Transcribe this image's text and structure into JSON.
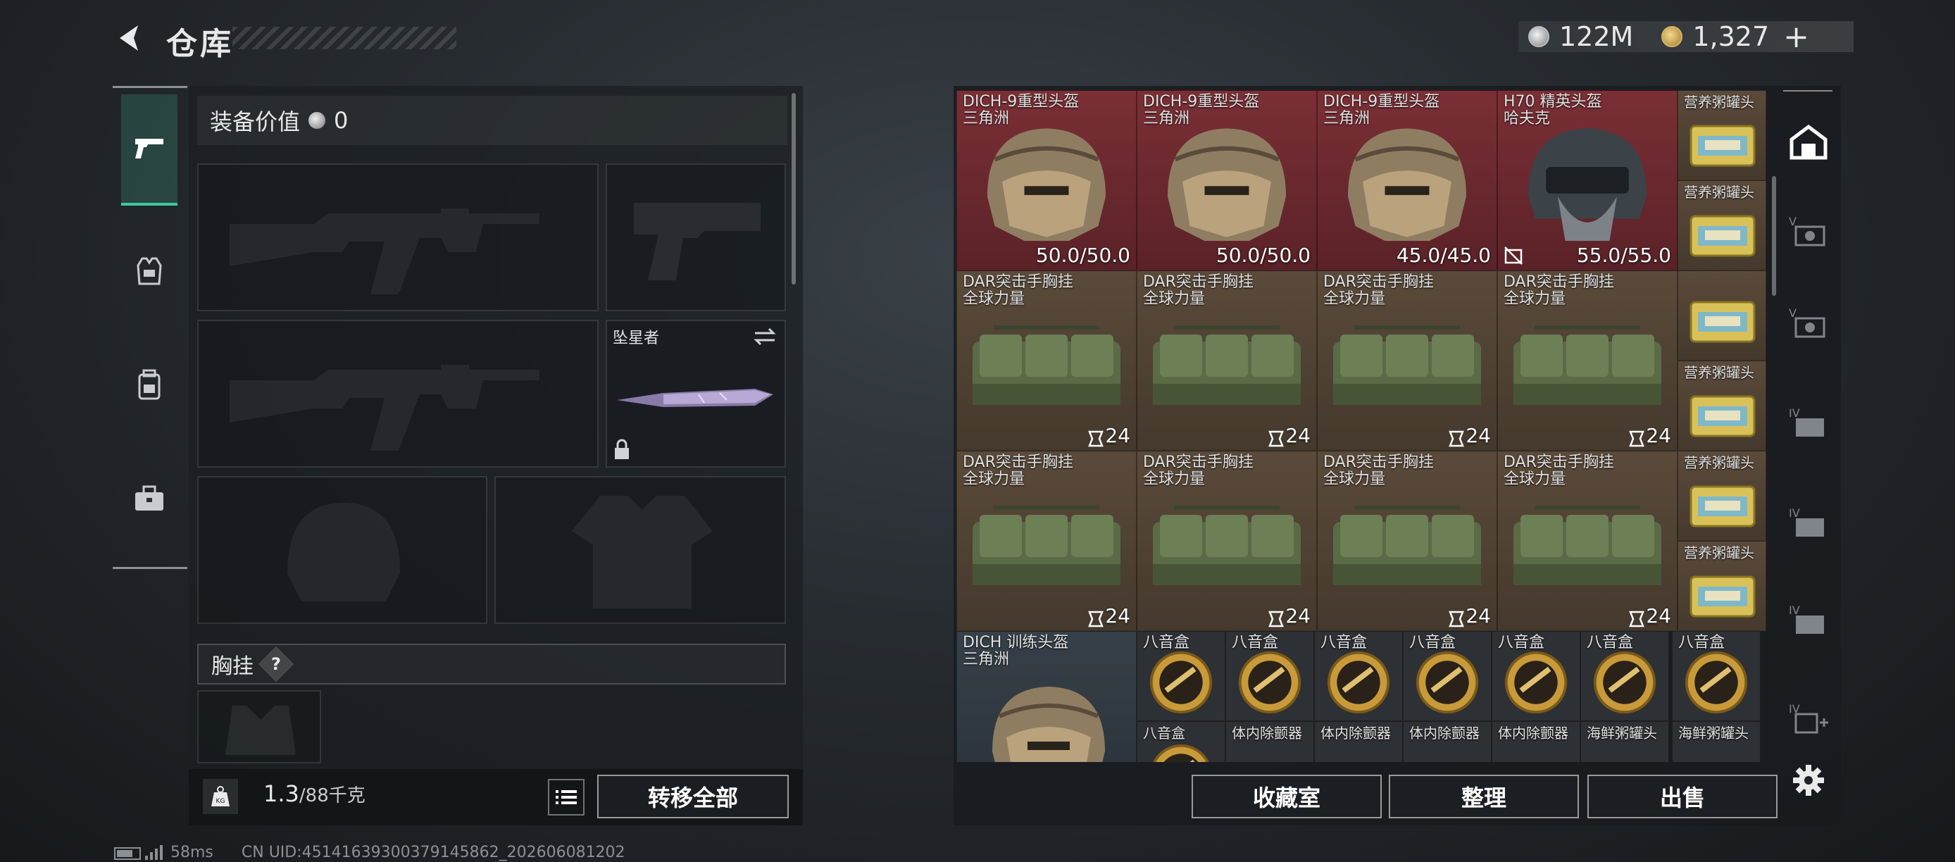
{
  "header": {
    "title": "仓库",
    "currency_silver": "122M",
    "currency_gold": "1,327",
    "add_symbol": "+"
  },
  "colors": {
    "accent": "#3fc7a0",
    "slot_red": "#6a2a30",
    "slot_brown": "#4f4133",
    "slot_green": "#35422a",
    "slot_slate": "#303a42"
  },
  "tabs": [
    {
      "name": "weapon-tab",
      "icon": "pistol-icon",
      "active": true
    },
    {
      "name": "armor-tab",
      "icon": "vest-icon",
      "active": false
    },
    {
      "name": "backpack-tab",
      "icon": "backpack-icon",
      "active": false
    },
    {
      "name": "case-tab",
      "icon": "briefcase-icon",
      "active": false
    }
  ],
  "equipment": {
    "value_label": "装备价值",
    "value": "0",
    "melee_name": "坠星者",
    "chest_rig_label": "胸挂",
    "chest_rig_help": "?"
  },
  "weight": {
    "current": "1.3",
    "max": "/88千克",
    "icon_text": "KG"
  },
  "buttons": {
    "transfer_all": "转移全部",
    "collection": "收藏室",
    "organize": "整理",
    "sell": "出售"
  },
  "inventory": {
    "row1": [
      {
        "name": "DICH-9重型头盔",
        "sub": "三角洲",
        "value": "50.0/50.0"
      },
      {
        "name": "DICH-9重型头盔",
        "sub": "三角洲",
        "value": "50.0/50.0"
      },
      {
        "name": "DICH-9重型头盔",
        "sub": "三角洲",
        "value": "45.0/45.0"
      },
      {
        "name": "H70 精英头盔",
        "sub": "哈夫克",
        "value": "55.0/55.0"
      }
    ],
    "rig_rows": [
      [
        {
          "name": "DAR突击手胸挂",
          "sub": "全球力量",
          "value": "24"
        },
        {
          "name": "DAR突击手胸挂",
          "sub": "全球力量",
          "value": "24"
        },
        {
          "name": "DAR突击手胸挂",
          "sub": "全球力量",
          "value": "24"
        },
        {
          "name": "DAR突击手胸挂",
          "sub": "全球力量",
          "value": "24"
        }
      ],
      [
        {
          "name": "DAR突击手胸挂",
          "sub": "全球力量",
          "value": "24"
        },
        {
          "name": "DAR突击手胸挂",
          "sub": "全球力量",
          "value": "24"
        },
        {
          "name": "DAR突击手胸挂",
          "sub": "全球力量",
          "value": "24"
        },
        {
          "name": "DAR突击手胸挂",
          "sub": "全球力量",
          "value": "24"
        }
      ]
    ],
    "cans": [
      "营养粥罐头",
      "营养粥罐头",
      "",
      "营养粥罐头",
      "营养粥罐头",
      "营养粥罐头"
    ],
    "training_helmet": {
      "name": "DICH 训练头盔",
      "sub": "三角洲"
    },
    "music_boxes": [
      "八音盒",
      "八音盒",
      "八音盒",
      "八音盒",
      "八音盒",
      "八音盒",
      "八音盒"
    ],
    "bottom_row": [
      "八音盒",
      "体内除颤器",
      "体内除颤器",
      "体内除颤器",
      "体内除颤器",
      "海鲜粥罐头",
      "海鲜粥罐头"
    ]
  },
  "status": {
    "ping": "58ms",
    "uid": "CN UID:45141639300379145862_202606081202"
  }
}
